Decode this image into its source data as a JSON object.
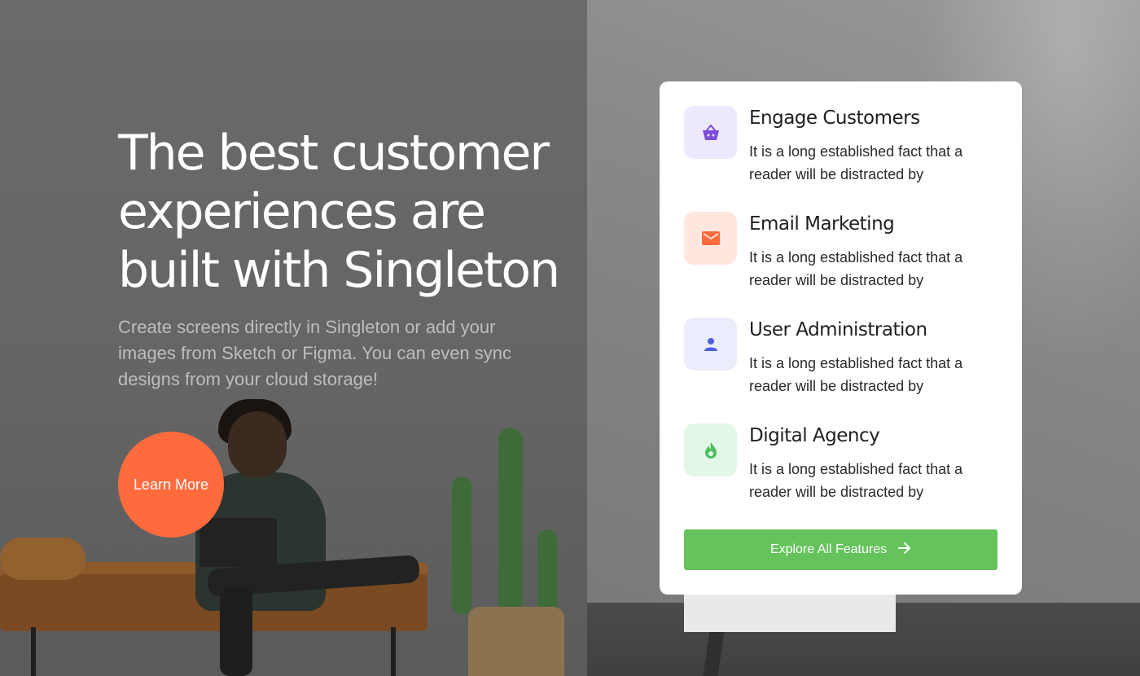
{
  "hero": {
    "title_line1": "The best customer",
    "title_line2": "experiences are",
    "title_line3": "built with Singleton",
    "subtitle_line1": "Create screens directly in Singleton or add your",
    "subtitle_line2": "images from Sketch or Figma. You can even sync",
    "subtitle_line3": "designs from your cloud storage!",
    "cta_label": "Learn More"
  },
  "features": {
    "items": [
      {
        "title": "Engage Customers",
        "desc_line1": "It is a long established fact that a",
        "desc_line2": "reader will be distracted by",
        "icon": "basket-icon",
        "icon_bg": "#eee9fe",
        "icon_color": "#7b4ddb"
      },
      {
        "title": "Email Marketing",
        "desc_line1": "It is a long established fact that a",
        "desc_line2": "reader will be distracted by",
        "icon": "envelope-icon",
        "icon_bg": "#ffe7e0",
        "icon_color": "#ff6b3d"
      },
      {
        "title": "User Administration",
        "desc_line1": "It is a long established fact that a",
        "desc_line2": "reader will be distracted by",
        "icon": "user-icon",
        "icon_bg": "#ebedfd",
        "icon_color": "#4d5fe0"
      },
      {
        "title": "Digital Agency",
        "desc_line1": "It is a long established fact that a",
        "desc_line2": "reader will be distracted by",
        "icon": "flame-icon",
        "icon_bg": "#e3f7e6",
        "icon_color": "#4fbf5d"
      }
    ],
    "explore_label": "Explore All Features",
    "explore_icon": "arrow-right-icon"
  },
  "colors": {
    "accent_orange": "#ff6b3d",
    "accent_green": "#64c35b"
  }
}
